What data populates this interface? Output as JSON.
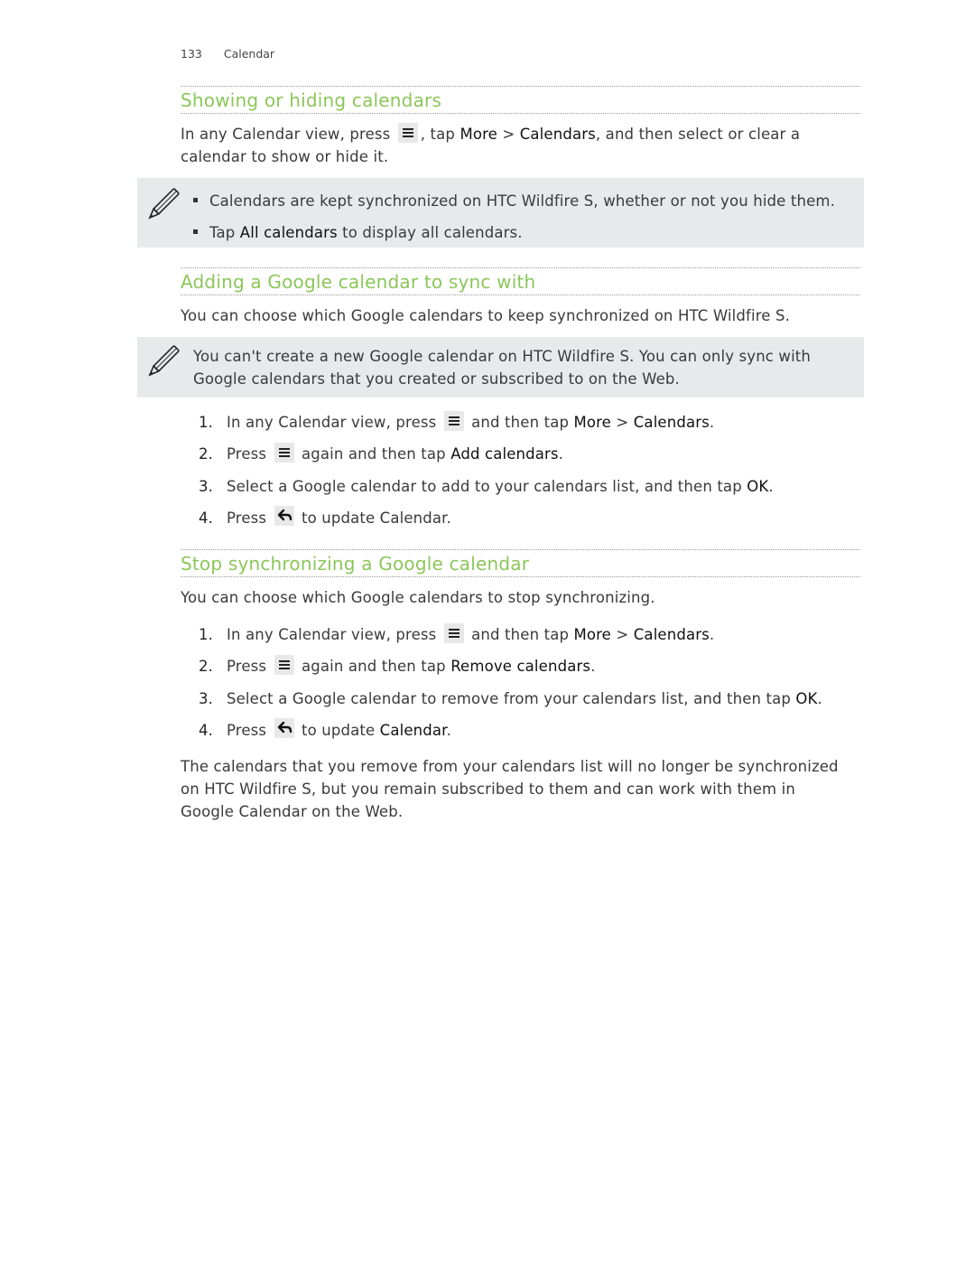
{
  "header": {
    "page_number": "133",
    "chapter": "Calendar"
  },
  "colors": {
    "heading": "#8cc65a",
    "note_background": "#e8e9ea",
    "body_text": "#3a3a3a"
  },
  "section1": {
    "title": "Showing or hiding calendars",
    "intro": {
      "t1": "In any Calendar view, press ",
      "icon": "menu-icon",
      "t2": ", tap ",
      "e1": "More",
      "t3": " > ",
      "e2": "Calendars",
      "t4": ", and then select or clear a",
      "line2": "calendar to show or hide it."
    },
    "notes": [
      {
        "text": "Calendars are kept synchronized on HTC Wildfire S, whether or not you hide them."
      },
      {
        "t1": "Tap ",
        "e1": "All calendars",
        "t2": " to display all calendars."
      }
    ]
  },
  "section2": {
    "title": "Adding a Google calendar to sync with",
    "intro": "You can choose which Google calendars to keep synchronized on HTC Wildfire S.",
    "note": {
      "line1": "You can't create a new Google calendar on HTC Wildfire S. You can only sync with",
      "line2": "Google calendars that you created or subscribed to on the Web."
    },
    "steps": [
      {
        "num": "1.",
        "t1": "In any Calendar view, press ",
        "icon": "menu-icon",
        "t2": " and then tap ",
        "e1": "More",
        "t3": " > ",
        "e2": "Calendars",
        "t4": "."
      },
      {
        "num": "2.",
        "t1": "Press ",
        "icon": "menu-icon",
        "t2": " again and then tap ",
        "e1": "Add calendars",
        "t3": "."
      },
      {
        "num": "3.",
        "t1": "Select a Google calendar to add to your calendars list, and then tap ",
        "e1": "OK",
        "t2": "."
      },
      {
        "num": "4.",
        "t1": "Press ",
        "icon": "back-icon",
        "t2": " to update Calendar."
      }
    ]
  },
  "section3": {
    "title": "Stop synchronizing a Google calendar",
    "intro": "You can choose which Google calendars to stop synchronizing.",
    "steps": [
      {
        "num": "1.",
        "t1": "In any Calendar view, press ",
        "icon": "menu-icon",
        "t2": " and then tap ",
        "e1": "More",
        "t3": " > ",
        "e2": "Calendars",
        "t4": "."
      },
      {
        "num": "2.",
        "t1": "Press ",
        "icon": "menu-icon",
        "t2": " again and then tap ",
        "e1": "Remove calendars",
        "t3": "."
      },
      {
        "num": "3.",
        "t1": "Select a Google calendar to remove from your calendars list, and then tap ",
        "e1": "OK",
        "t2": "."
      },
      {
        "num": "4.",
        "t1": "Press ",
        "icon": "back-icon",
        "t2": " to update ",
        "e1": "Calendar",
        "t3": "."
      }
    ],
    "outro": {
      "line1": "The calendars that you remove from your calendars list will no longer be synchronized",
      "line2": "on HTC Wildfire S, but you remain subscribed to them and can work with them in",
      "line3": "Google Calendar on the Web."
    }
  }
}
